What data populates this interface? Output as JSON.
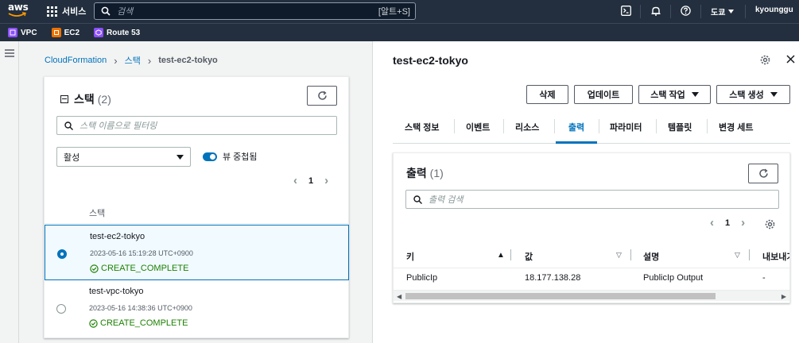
{
  "topnav": {
    "logo_text": "aws",
    "services_label": "서비스",
    "search_placeholder": "검색",
    "search_shortcut": "[알트+S]",
    "region_label": "도쿄",
    "account_label": "kyounggu",
    "icons": [
      "cloudshell-icon",
      "bell-icon",
      "help-icon"
    ]
  },
  "favorites": [
    {
      "label": "VPC",
      "color": "#8c4fff"
    },
    {
      "label": "EC2",
      "color": "#ed7100"
    },
    {
      "label": "Route 53",
      "color": "#8c4fff"
    }
  ],
  "breadcrumb": {
    "root": "CloudFormation",
    "section": "스택",
    "current": "test-ec2-tokyo"
  },
  "stacks_panel": {
    "title": "스택",
    "count": "(2)",
    "filter_placeholder": "스택 이름으로 필터링",
    "status_filter": "활성",
    "nested_view_label": "뷰 중첩됨",
    "page": "1",
    "column_header": "스택",
    "rows": [
      {
        "name": "test-ec2-tokyo",
        "date": "2023-05-16 15:19:28 UTC+0900",
        "status": "CREATE_COMPLETE",
        "selected": true
      },
      {
        "name": "test-vpc-tokyo",
        "date": "2023-05-16 14:38:36 UTC+0900",
        "status": "CREATE_COMPLETE",
        "selected": false
      }
    ]
  },
  "detail": {
    "title": "test-ec2-tokyo",
    "buttons": {
      "delete": "삭제",
      "update": "업데이트",
      "stack_actions": "스택 작업",
      "create_stack": "스택 생성"
    },
    "tabs": [
      "스택 정보",
      "이벤트",
      "리소스",
      "출력",
      "파라미터",
      "템플릿",
      "변경 세트"
    ],
    "active_tab": "출력",
    "outputs": {
      "title": "출력",
      "count": "(1)",
      "search_placeholder": "출력 검색",
      "page": "1",
      "columns": [
        "키",
        "값",
        "설명",
        "내보내기"
      ],
      "rows": [
        {
          "key": "PublicIp",
          "value": "18.177.138.28",
          "description": "PublicIp Output",
          "export": "-"
        }
      ]
    }
  },
  "colors": {
    "nav_bg": "#232f3e",
    "link": "#0073bb",
    "success": "#1d8102"
  }
}
